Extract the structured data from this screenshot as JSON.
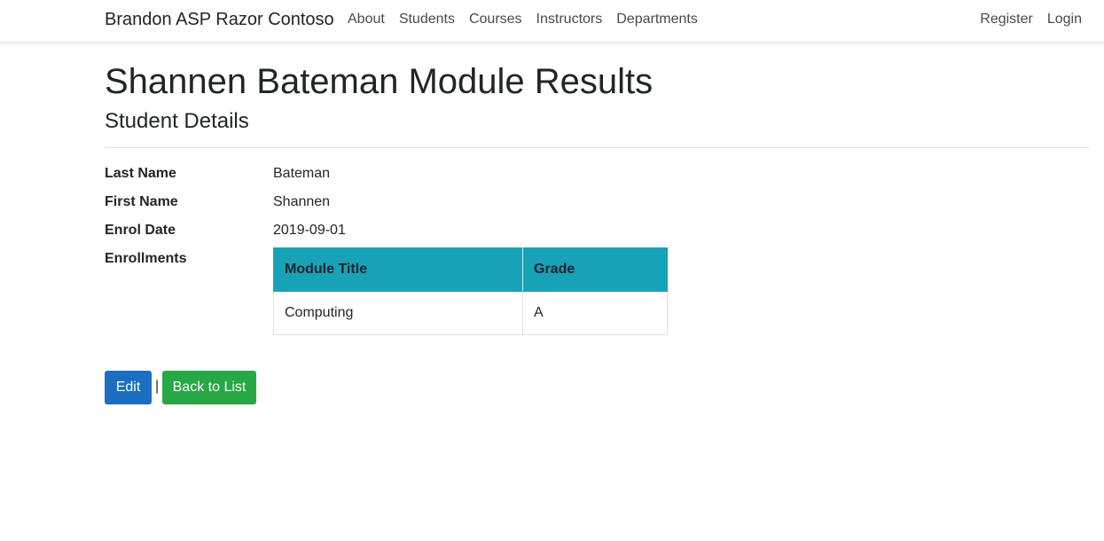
{
  "navbar": {
    "brand": "Brandon ASP Razor Contoso",
    "left_items": [
      "About",
      "Students",
      "Courses",
      "Instructors",
      "Departments"
    ],
    "right_items": [
      "Register",
      "Login"
    ]
  },
  "page": {
    "title": "Shannen Bateman Module Results",
    "subtitle": "Student Details"
  },
  "details": {
    "last_name_label": "Last Name",
    "last_name_value": "Bateman",
    "first_name_label": "First Name",
    "first_name_value": "Shannen",
    "enrol_date_label": "Enrol Date",
    "enrol_date_value": "2019-09-01",
    "enrollments_label": "Enrollments"
  },
  "enrollments": {
    "headers": [
      "Module Title",
      "Grade"
    ],
    "rows": [
      [
        "Computing",
        "A"
      ]
    ]
  },
  "actions": {
    "edit_label": "Edit",
    "separator": "|",
    "back_label": "Back to List"
  },
  "colors": {
    "table_header": "#17a2b8",
    "edit_button": "#1b6ec2",
    "back_button": "#28a745"
  }
}
